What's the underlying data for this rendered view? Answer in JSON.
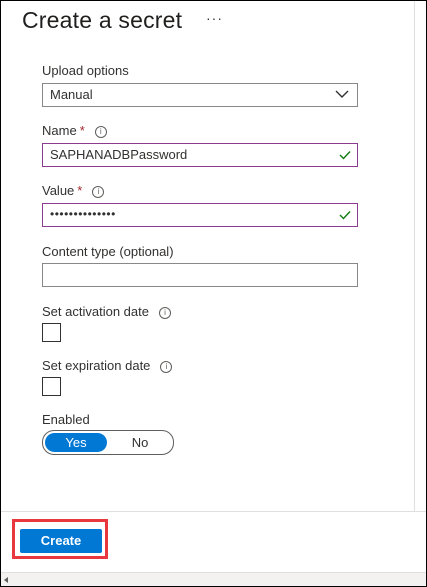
{
  "panel": {
    "title": "Create a secret",
    "more_label": "···"
  },
  "upload_options": {
    "label": "Upload options",
    "value": "Manual"
  },
  "name": {
    "label": "Name",
    "required_mark": "*",
    "value": "SAPHANADBPassword"
  },
  "value_field": {
    "label": "Value",
    "required_mark": "*",
    "masked_value": "••••••••••••••"
  },
  "content_type": {
    "label": "Content type (optional)",
    "value": ""
  },
  "activation": {
    "label": "Set activation date"
  },
  "expiration": {
    "label": "Set expiration date"
  },
  "enabled": {
    "label": "Enabled",
    "yes": "Yes",
    "no": "No",
    "selected": "Yes"
  },
  "footer": {
    "create_label": "Create"
  },
  "colors": {
    "accent": "#0078d4",
    "valid": "#107c10",
    "required": "#a4262c",
    "highlight": "#e8383d"
  }
}
